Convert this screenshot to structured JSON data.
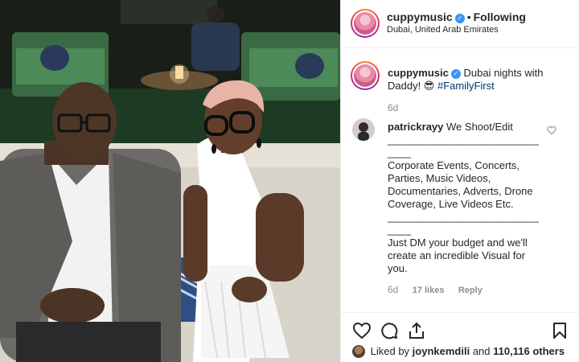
{
  "post": {
    "author": "cuppymusic",
    "follow_separator": "•",
    "follow_status": "Following",
    "location": "Dubai, United Arab Emirates",
    "caption_text": "Dubai nights with Daddy! 😎 ",
    "caption_hashtag": "#FamilyFirst",
    "caption_time": "6d"
  },
  "comment": {
    "author": "patrickrayy",
    "text": "We Shoot/Edit\n______________________________\nCorporate Events, Concerts, Parties, Music Videos, Documentaries, Adverts, Drone Coverage, Live Videos Etc.\n______________________________\nJust DM your budget and we'll create an incredible Visual for you.",
    "time": "6d",
    "likes": "17 likes",
    "reply": "Reply"
  },
  "likes": {
    "prefix": "Liked by",
    "user": "joynkemdili",
    "and": "and",
    "count": "110,116 others"
  },
  "icons": {
    "verified": "verified-badge",
    "heart": "heart-icon",
    "comment": "comment-icon",
    "share": "share-icon",
    "save": "bookmark-icon"
  },
  "colors": {
    "link": "#003569",
    "muted": "#8e8e8e",
    "verified": "#3897f0"
  }
}
